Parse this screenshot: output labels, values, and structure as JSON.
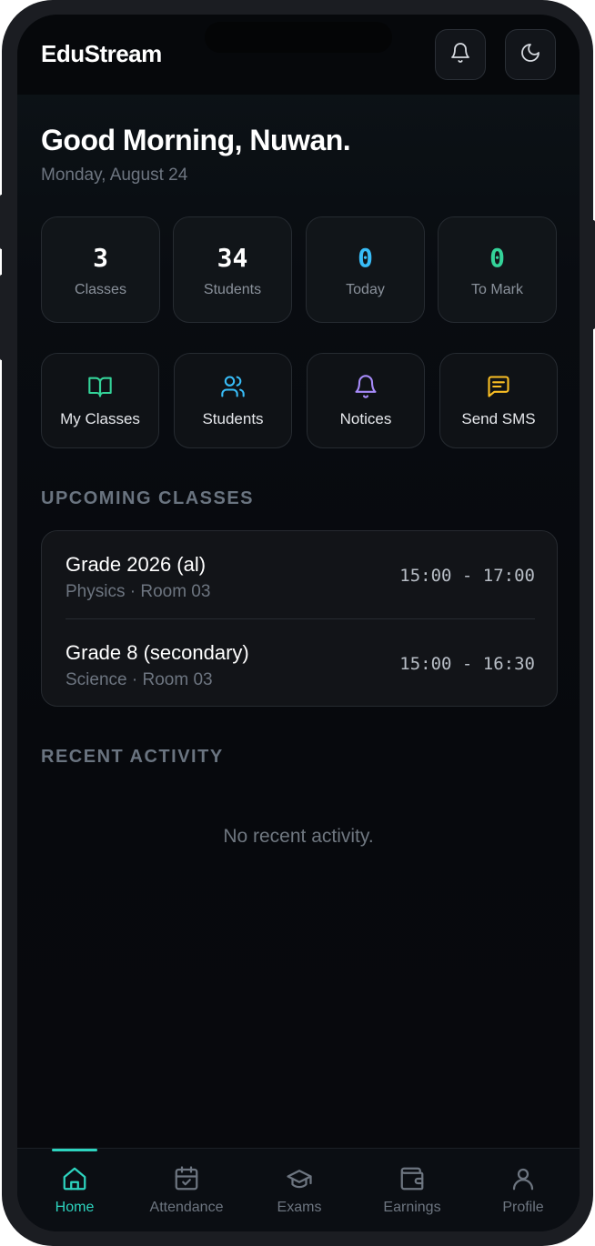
{
  "app": {
    "title": "EduStream"
  },
  "header": {
    "notifications_icon": "bell-icon",
    "theme_icon": "moon-icon"
  },
  "greeting": {
    "title": "Good Morning, Nuwan.",
    "date": "Monday, August 24"
  },
  "stats": [
    {
      "value": "3",
      "label": "Classes",
      "color": "#ffffff"
    },
    {
      "value": "34",
      "label": "Students",
      "color": "#ffffff"
    },
    {
      "value": "0",
      "label": "Today",
      "color": "#38bdf8"
    },
    {
      "value": "0",
      "label": "To Mark",
      "color": "#34d399"
    }
  ],
  "quick_actions": [
    {
      "label": "My Classes",
      "icon": "book-open-icon",
      "color": "#34d399"
    },
    {
      "label": "Students",
      "icon": "users-icon",
      "color": "#38bdf8"
    },
    {
      "label": "Notices",
      "icon": "bell-icon",
      "color": "#a78bfa"
    },
    {
      "label": "Send SMS",
      "icon": "message-icon",
      "color": "#fbbf24"
    }
  ],
  "upcoming": {
    "title": "UPCOMING CLASSES",
    "items": [
      {
        "name": "Grade 2026 (al)",
        "details": "Physics · Room 03",
        "time": "15:00 - 17:00"
      },
      {
        "name": "Grade 8 (secondary)",
        "details": "Science · Room 03",
        "time": "15:00 - 16:30"
      }
    ]
  },
  "activity": {
    "title": "RECENT ACTIVITY",
    "empty": "No recent activity."
  },
  "nav": {
    "active_color": "#2dd4bf",
    "items": [
      {
        "label": "Home",
        "icon": "home-icon"
      },
      {
        "label": "Attendance",
        "icon": "calendar-check-icon"
      },
      {
        "label": "Exams",
        "icon": "graduation-cap-icon"
      },
      {
        "label": "Earnings",
        "icon": "wallet-icon"
      },
      {
        "label": "Profile",
        "icon": "user-icon"
      }
    ]
  }
}
